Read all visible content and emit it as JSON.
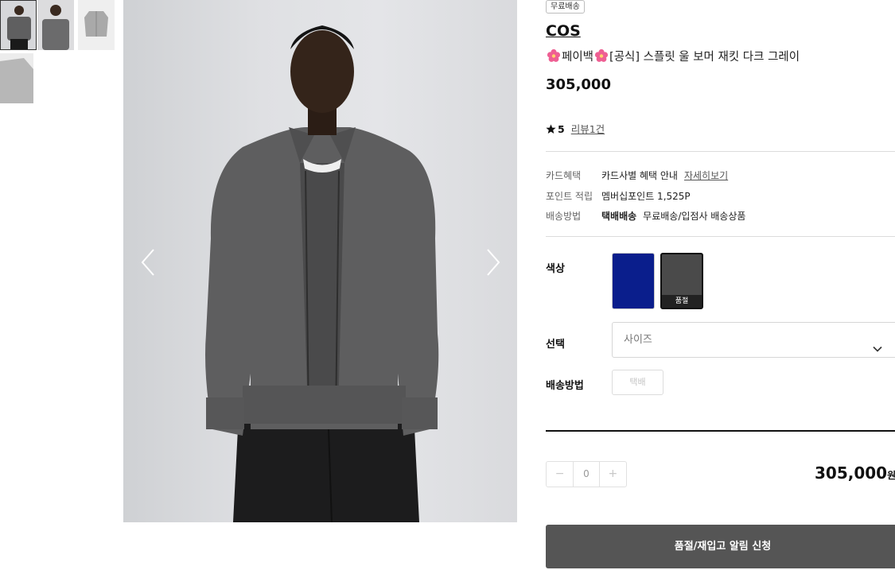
{
  "product": {
    "shipping_badge": "무료배송",
    "brand": "COS",
    "title_prefix": "페이백",
    "title_main": "[공식] 스플릿 울 보머 재킷 다크 그레이",
    "price": "305,000",
    "rating_score": "5",
    "review_link": "리뷰1건"
  },
  "benefits": {
    "card_label": "카드혜택",
    "card_value": "카드사별 혜택 안내",
    "card_link": "자세히보기",
    "point_label": "포인트 적립",
    "point_value": "멤버십포인트 1,525P",
    "delivery_label": "배송방법",
    "delivery_type": "택배배송",
    "delivery_value": "무료배송/입점사 배송상품"
  },
  "options": {
    "color_label": "색상",
    "soldout_tag": "품절",
    "select_label": "선택",
    "size_placeholder": "사이즈",
    "shipping_label": "배송방법",
    "shipping_button": "택배"
  },
  "purchase": {
    "qty_minus": "−",
    "qty_value": "0",
    "qty_plus": "+",
    "total": "305,000",
    "currency": "원",
    "notify_button": "품절/재입고 알림 신청"
  },
  "colors": {
    "swatch_blue": "#0a1e8c",
    "swatch_grey": "#4a4a4a",
    "notify_bg": "#555555"
  }
}
